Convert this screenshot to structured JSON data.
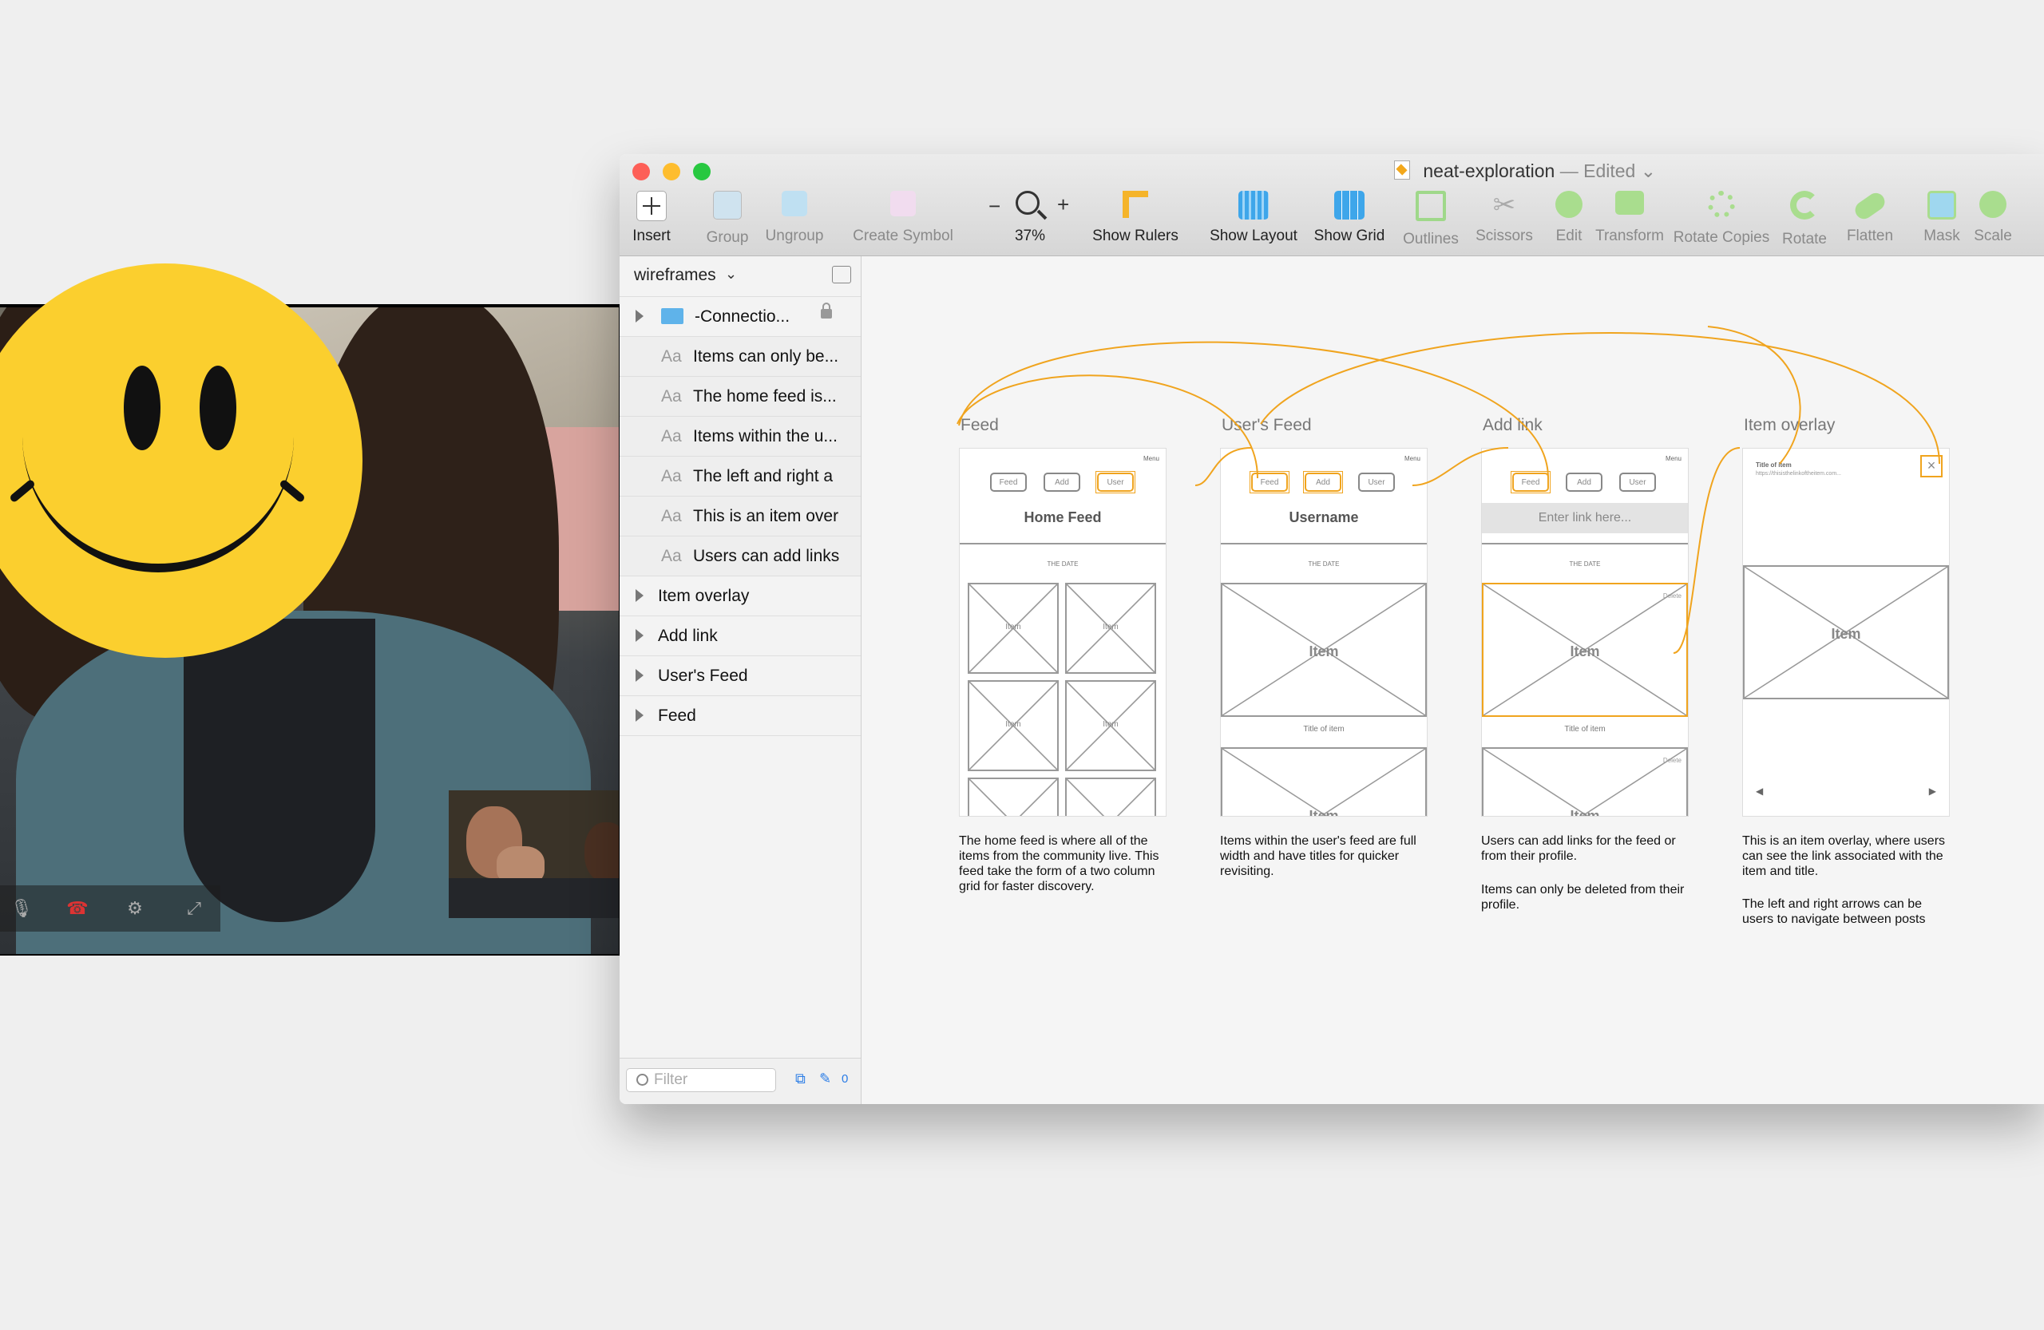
{
  "window": {
    "doc_name": "neat-exploration",
    "doc_status": "— Edited",
    "traffic_colors": [
      "#fd5f57",
      "#febd2e",
      "#28c840"
    ]
  },
  "toolbar": {
    "insert": "Insert",
    "group": "Group",
    "ungroup": "Ungroup",
    "create_symbol": "Create Symbol",
    "zoom_minus": "−",
    "zoom_plus": "+",
    "zoom_value": "37%",
    "show_rulers": "Show Rulers",
    "show_layout": "Show Layout",
    "show_grid": "Show Grid",
    "outlines": "Outlines",
    "scissors": "Scissors",
    "edit": "Edit",
    "transform": "Transform",
    "rotate_copies": "Rotate Copies",
    "rotate": "Rotate",
    "flatten": "Flatten",
    "mask": "Mask",
    "scale": "Scale"
  },
  "layers": {
    "page_name": "wireframes",
    "connections": "-Connectio...",
    "text_prefix": "Aa",
    "text_layers": [
      "Items can only be...",
      "The home feed is...",
      "Items within the u...",
      "The left and right a",
      "This is an item over",
      "Users can add links"
    ],
    "artboards": [
      "Item overlay",
      "Add link",
      "User's Feed",
      "Feed"
    ],
    "filter_placeholder": "Filter",
    "footer_count": "0"
  },
  "canvas": {
    "menu": "Menu",
    "item": "Item",
    "the_date": "THE DATE",
    "title_of_item": "Title of item",
    "delete": "Delete",
    "nav_left": "◀",
    "nav_right": "▶",
    "close": "×",
    "buttons": [
      "Feed",
      "Add",
      "User"
    ],
    "feed": {
      "title": "Feed",
      "heading": "Home Feed",
      "desc": "The home feed is where all of the items from the community live. This feed take the form of a two column grid for faster discovery."
    },
    "users_feed": {
      "title": "User's Feed",
      "heading": "Username",
      "desc": "Items within the user's feed are full width and have titles for quicker revisiting."
    },
    "add_link": {
      "title": "Add link",
      "input_placeholder": "Enter link here...",
      "desc1": "Users can add links for the feed or from their profile.",
      "desc2": "Items can only be deleted from their profile."
    },
    "item_overlay": {
      "title": "Item overlay",
      "item_title": "Title of item",
      "item_url": "https://thisisthelinkoftheitem.com...",
      "desc1": "This is an item overlay, where users can see the link associated with the item and title.",
      "desc2": "The left and right arrows can be users to navigate between posts"
    },
    "link_color": "#f0a41e"
  },
  "colors": {
    "smiley": "#fbcf2e",
    "canvas_bg": "#f5f5f5"
  }
}
